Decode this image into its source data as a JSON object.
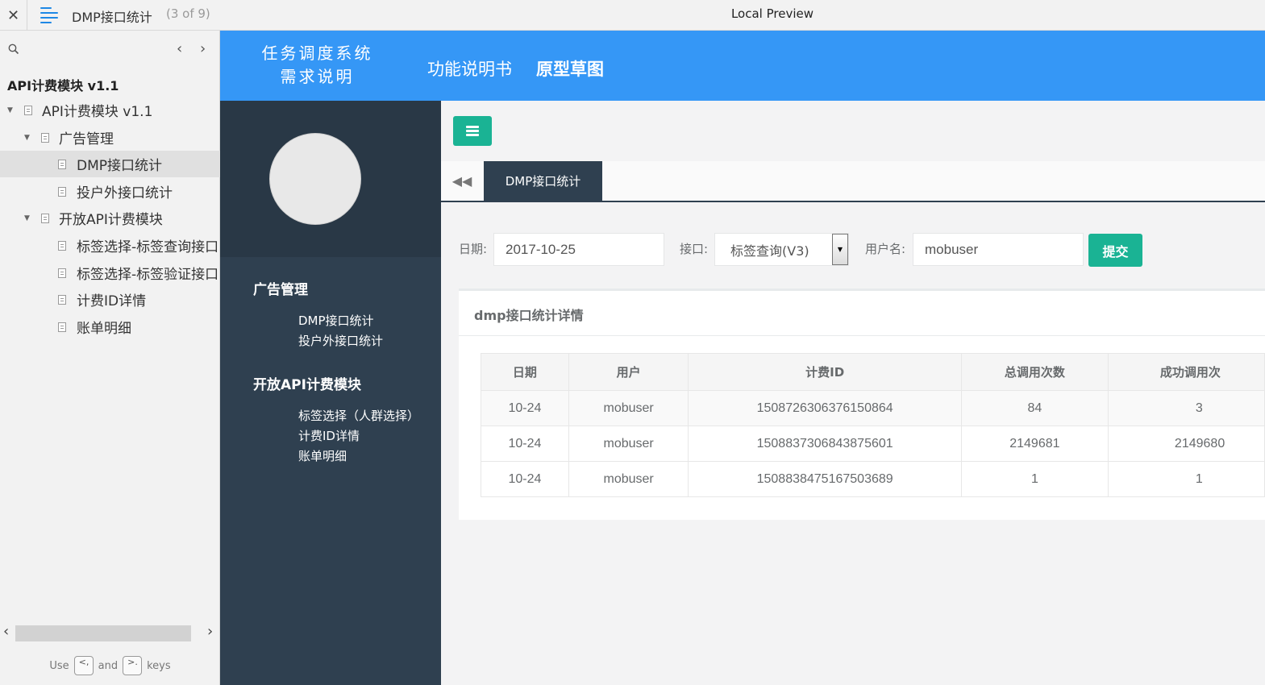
{
  "topbar": {
    "close_icon": "close-icon",
    "menu_icon": "hamburger-icon",
    "page_title": "DMP接口统计",
    "page_count": "(3 of 9)",
    "preview_label": "Local Preview"
  },
  "sitemap": {
    "search_icon": "search-icon",
    "prev_arrow": "‹",
    "next_arrow": "›",
    "project_title": "API计费模块 v1.1",
    "tree": [
      {
        "label": "API计费模块 v1.1",
        "level": 0,
        "expandable": true
      },
      {
        "label": "广告管理",
        "level": 1,
        "expandable": true
      },
      {
        "label": "DMP接口统计",
        "level": 2,
        "expandable": false,
        "active": true
      },
      {
        "label": "投户外接口统计",
        "level": 2,
        "expandable": false
      },
      {
        "label": "开放API计费模块",
        "level": 1,
        "expandable": true
      },
      {
        "label": "标签选择-标签查询接口",
        "level": 2,
        "expandable": false
      },
      {
        "label": "标签选择-标签验证接口",
        "level": 2,
        "expandable": false
      },
      {
        "label": "计费ID详情",
        "level": 2,
        "expandable": false
      },
      {
        "label": "账单明细",
        "level": 2,
        "expandable": false
      }
    ],
    "hint": {
      "use": "Use",
      "key1": "<,",
      "and": "and",
      "key2": ">.",
      "keys": "keys"
    }
  },
  "header": {
    "logo_line1": "任务调度系统",
    "logo_line2": "需求说明",
    "nav_spec": "功能说明书",
    "nav_prototype": "原型草图"
  },
  "sidenav": {
    "group1_title": "广告管理",
    "group1_items": [
      "DMP接口统计",
      "投户外接口统计"
    ],
    "group2_title": "开放API计费模块",
    "group2_items": [
      "标签选择（人群选择）",
      "计费ID详情",
      "账单明细"
    ]
  },
  "tabs": {
    "active_tab": "DMP接口统计"
  },
  "form": {
    "date_label": "日期:",
    "date_value": "2017-10-25",
    "api_label": "接口:",
    "api_value": "标签查询(V3)",
    "user_label": "用户名:",
    "user_value": "mobuser",
    "submit_label": "提交"
  },
  "panel": {
    "title": "dmp接口统计详情",
    "columns": [
      "日期",
      "用户",
      "计费ID",
      "总调用次数",
      "成功调用次"
    ],
    "rows": [
      [
        "10-24",
        "mobuser",
        "1508726306376150864",
        "84",
        "3"
      ],
      [
        "10-24",
        "mobuser",
        "1508837306843875601",
        "2149681",
        "2149680"
      ],
      [
        "10-24",
        "mobuser",
        "1508838475167503689",
        "1",
        "1"
      ]
    ]
  },
  "colors": {
    "header_blue": "#3597f6",
    "sidenav_dark": "#2f4050",
    "accent_green": "#1ab394"
  }
}
